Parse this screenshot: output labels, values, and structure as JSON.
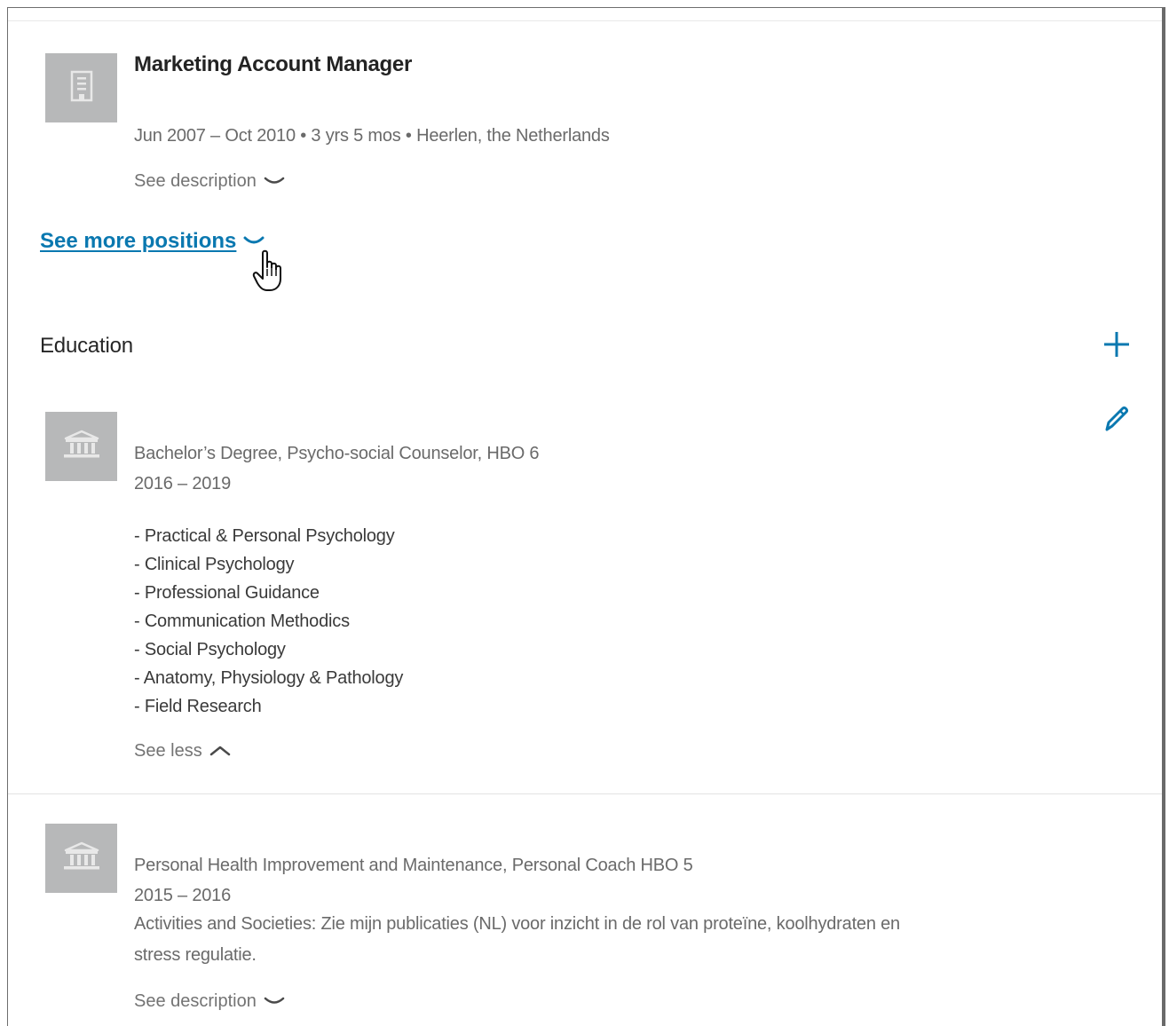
{
  "experience": {
    "position": {
      "title": "Marketing Account Manager",
      "meta": "Jun 2007 – Oct 2010 • 3 yrs 5 mos • Heerlen, the Netherlands",
      "see_description": "See description",
      "logo_icon": "building-icon"
    },
    "see_more_positions": "See more positions"
  },
  "education": {
    "section_title": "Education",
    "add_icon": "plus-icon",
    "edit_icon": "pencil-icon",
    "entries": [
      {
        "degree": "Bachelor’s Degree, Psycho-social Counselor, HBO 6",
        "dates": "2016 – 2019",
        "description": [
          "- Practical & Personal Psychology",
          "- Clinical Psychology",
          "- Professional Guidance",
          "- Communication Methodics",
          "- Social Psychology",
          "- Anatomy, Physiology & Pathology",
          "- Field Research"
        ],
        "see_less": "See less",
        "logo_icon": "school-icon"
      },
      {
        "degree": "Personal Health Improvement and Maintenance, Personal Coach HBO 5",
        "dates": "2015 – 2016",
        "activities_line1": "Activities and Societies: Zie mijn publicaties (NL) voor inzicht in de rol van proteïne, koolhydraten en",
        "activities_line2": "stress regulatie.",
        "see_description": "See description",
        "logo_icon": "school-icon"
      }
    ]
  },
  "colors": {
    "link": "#0a78b0",
    "logo_placeholder": "#b7b8b9"
  }
}
